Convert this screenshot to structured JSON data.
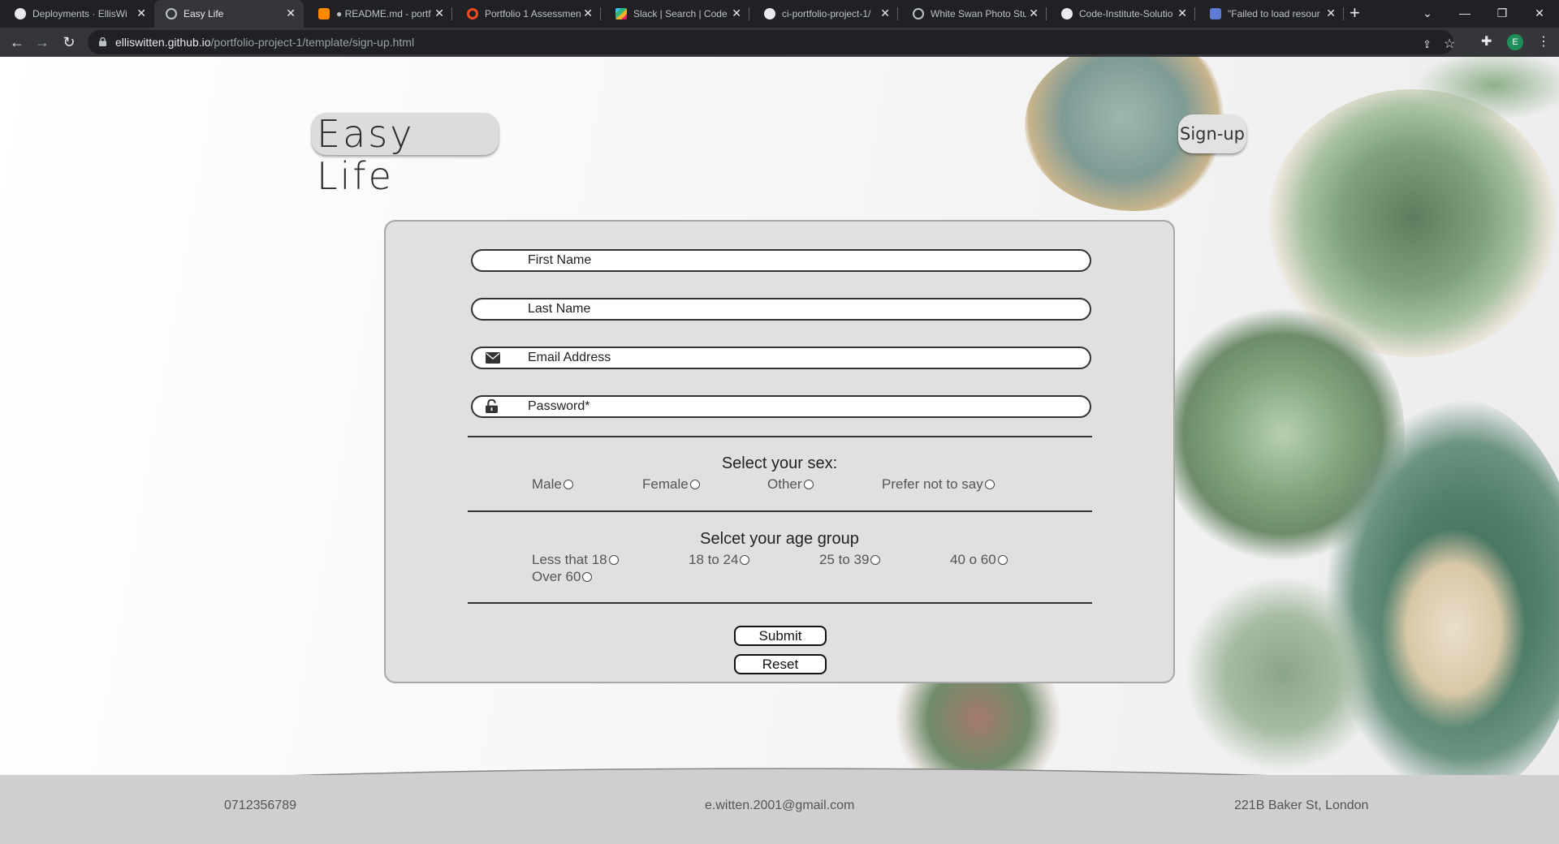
{
  "browser": {
    "tabs": [
      {
        "label": "Deployments · EllisWi",
        "fav": "github-icon",
        "active": false
      },
      {
        "label": "Easy Life",
        "fav": "globe-icon",
        "active": true
      },
      {
        "label": "● README.md - portf",
        "fav": "gitpod-icon",
        "active": false
      },
      {
        "label": "Portfolio 1 Assessment",
        "fav": "circle-icon",
        "active": false
      },
      {
        "label": "Slack | Search | Code I",
        "fav": "slack-icon",
        "active": false
      },
      {
        "label": "ci-portfolio-project-1/",
        "fav": "github-icon",
        "active": false
      },
      {
        "label": "White Swan Photo Stu",
        "fav": "globe-icon",
        "active": false
      },
      {
        "label": "Code-Institute-Solutio",
        "fav": "github-icon",
        "active": false
      },
      {
        "label": "\"Failed to load resour",
        "fav": "people-icon",
        "active": false
      }
    ],
    "url_host": "elliswitten.github.io",
    "url_path": "/portfolio-project-1/template/sign-up.html",
    "profile_initial": "E"
  },
  "header": {
    "logo": "Easy Life",
    "nav_signup": "Sign-up"
  },
  "form": {
    "first_name_placeholder": "First Name",
    "last_name_placeholder": "Last Name",
    "email_placeholder": "Email Address",
    "password_placeholder": "Password*",
    "sex_title": "Select your sex:",
    "sex_options": [
      "Male",
      "Female",
      "Other",
      "Prefer not to say"
    ],
    "age_title": "Selcet your age group",
    "age_options": [
      "Less that 18",
      "18 to 24",
      "25 to 39",
      "40 o 60",
      "Over 60"
    ],
    "submit_label": "Submit",
    "reset_label": "Reset"
  },
  "footer": {
    "phone": "0712356789",
    "email": "e.witten.2001@gmail.com",
    "address": "221B Baker St, London"
  }
}
